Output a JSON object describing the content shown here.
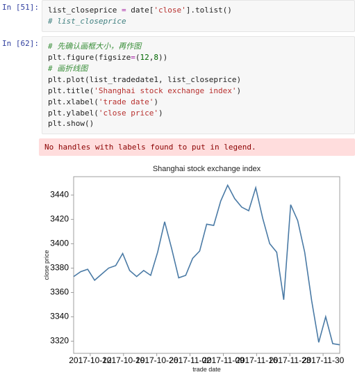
{
  "cells": [
    {
      "prompt": "In [51]:",
      "code": {
        "l1a": "list_closeprice ",
        "l1b": "=",
        "l1c": " date[",
        "l1d": "'close'",
        "l1e": "].tolist()",
        "l2": "# list_closeprice"
      }
    },
    {
      "prompt": "In [62]:",
      "code": {
        "l1": "# 先确认画框大小，再作图",
        "l2a": "plt.figure(figsize",
        "l2b": "=",
        "l2c": "(",
        "l2d": "12",
        "l2e": ",",
        "l2f": "8",
        "l2g": "))",
        "l3": "# 画折线图",
        "l4": "plt.plot(list_tradedate1, list_closeprice)",
        "l5": "",
        "l6a": "plt.title(",
        "l6b": "'Shanghai stock exchange index'",
        "l6c": ")",
        "l7a": "plt.xlabel(",
        "l7b": "'trade date'",
        "l7c": ")",
        "l8a": "plt.ylabel(",
        "l8b": "'close price'",
        "l8c": ")",
        "l9": "",
        "l10": "",
        "l11": "plt.show()"
      }
    }
  ],
  "stderr": "No handles with labels found to put in legend.",
  "chart_data": {
    "type": "line",
    "title": "Shanghai stock exchange index",
    "xlabel": "trade date",
    "ylabel": "close price",
    "ylim": [
      3310,
      3455
    ],
    "yticks": [
      3320,
      3340,
      3360,
      3380,
      3400,
      3420,
      3440
    ],
    "xticks": [
      "2017-10-12",
      "2017-10-19",
      "2017-10-26",
      "2017-11-02",
      "2017-11-09",
      "2017-11-16",
      "2017-11-23",
      "2017-11-30"
    ],
    "values": [
      3373,
      3377,
      3379,
      3370,
      3375,
      3380,
      3382,
      3392,
      3378,
      3373,
      3378,
      3374,
      3393,
      3418,
      3396,
      3372,
      3374,
      3388,
      3394,
      3416,
      3415,
      3435,
      3448,
      3437,
      3430,
      3427,
      3446,
      3421,
      3400,
      3393,
      3354,
      3432,
      3419,
      3393,
      3353,
      3319,
      3340,
      3318,
      3317
    ]
  }
}
